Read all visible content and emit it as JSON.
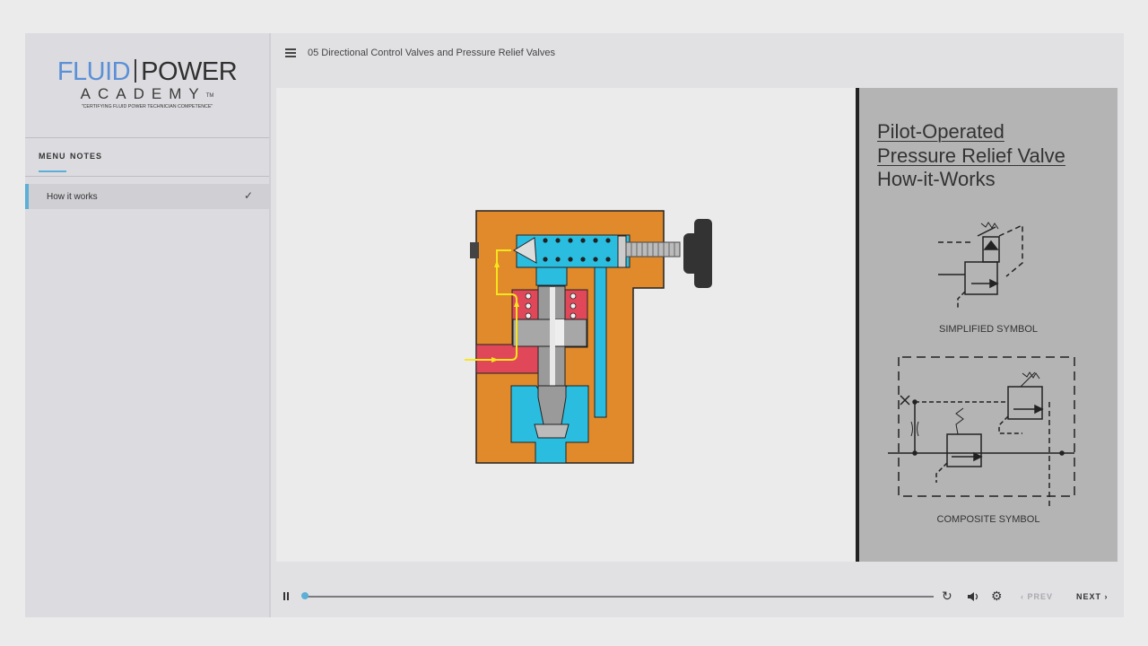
{
  "brand": {
    "word1": "FLUID",
    "word2": "POWER",
    "word3": "ACADEMY",
    "tm": "TM",
    "tagline": "\"CERTIFYING FLUID POWER TECHNICIAN COMPETENCE\""
  },
  "sidebar": {
    "tabs": [
      {
        "label": "MENU",
        "active": true
      },
      {
        "label": "NOTES",
        "active": false
      }
    ],
    "items": [
      {
        "label": "How it works",
        "done": true,
        "check": "✓"
      }
    ]
  },
  "header": {
    "title": "05 Directional Control Valves and Pressure Relief Valves"
  },
  "slide": {
    "title_lines": [
      "Pilot-Operated",
      "Pressure Relief Valve",
      "How-it-Works"
    ],
    "symbols": [
      {
        "caption": "SIMPLIFIED SYMBOL"
      },
      {
        "caption": "COMPOSITE SYMBOL"
      }
    ]
  },
  "player": {
    "state": "paused",
    "progress": 0.0,
    "prev_label": "PREV",
    "next_label": "NEXT",
    "icons": [
      "pause-icon",
      "replay-icon",
      "volume-icon",
      "settings-icon",
      "chevron-left-icon",
      "chevron-right-icon",
      "hamburger-icon"
    ]
  },
  "colors": {
    "accent": "#5cafd6",
    "valve_body": "#e08a2c",
    "pilot_chamber": "#2bbde0",
    "inlet_pressure": "#e0485a",
    "flow_arrow": "#f5e61d",
    "info_panel": "#b4b4b4"
  }
}
